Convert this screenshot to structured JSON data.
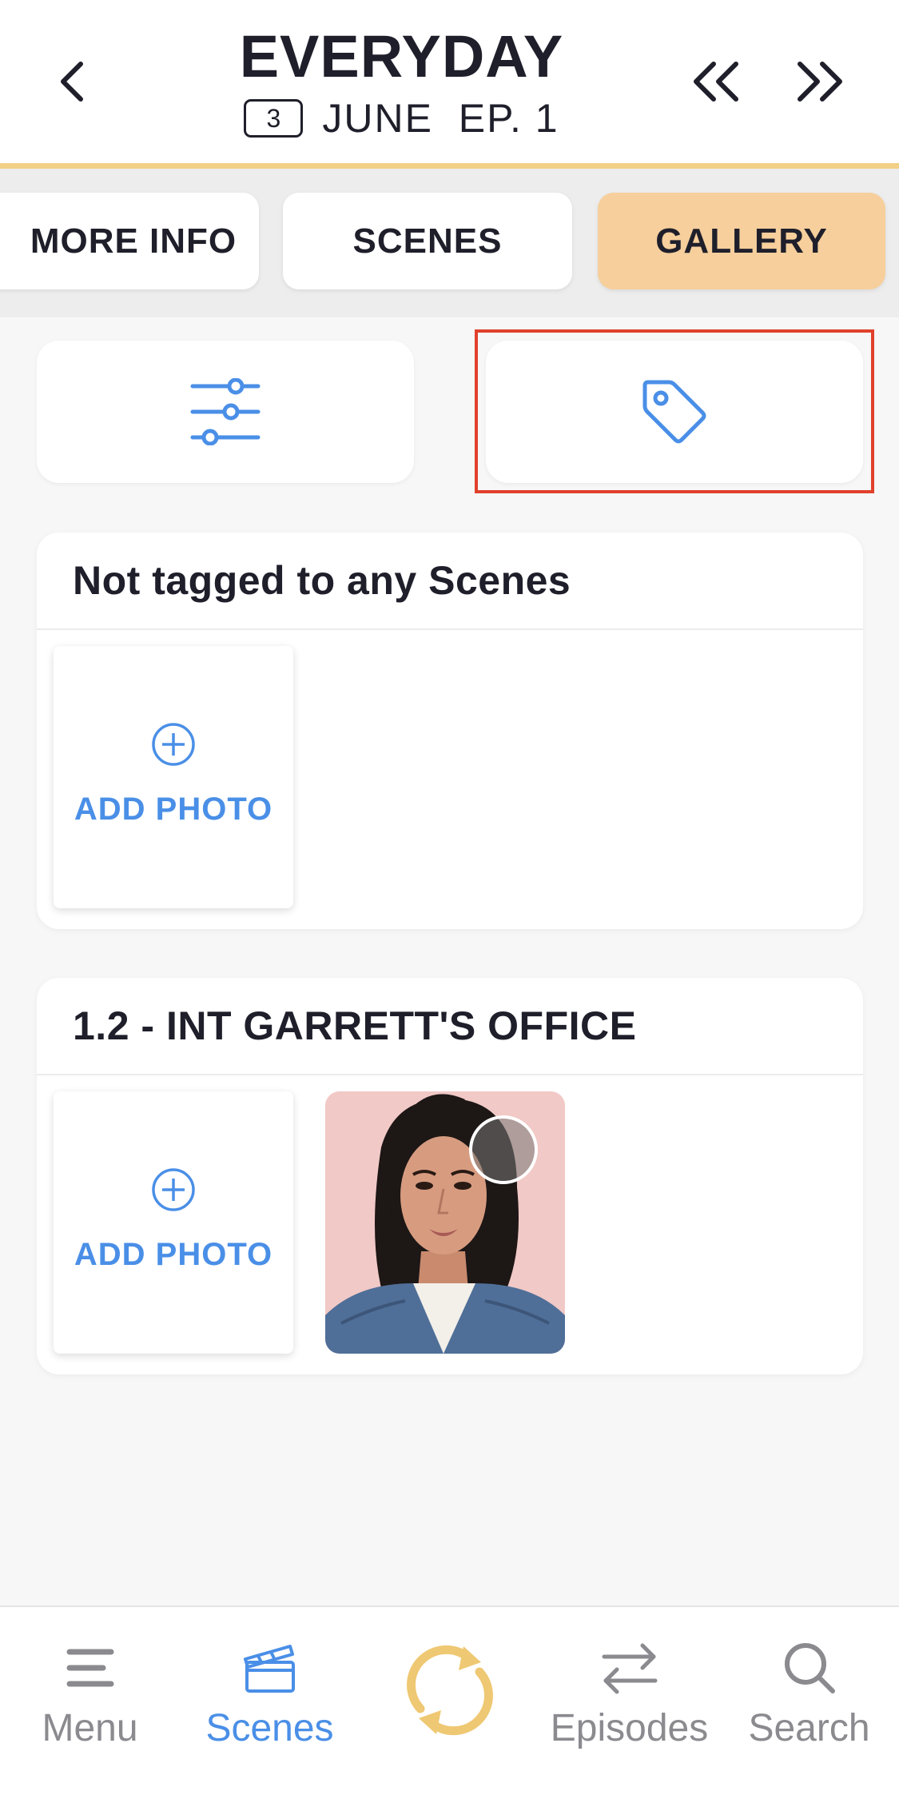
{
  "header": {
    "title": "EVERYDAY",
    "day_number": "3",
    "subtitle": "JUNE  EP. 1"
  },
  "tabs": [
    {
      "label": "MORE INFO"
    },
    {
      "label": "SCENES"
    },
    {
      "label": "GALLERY",
      "active": true
    }
  ],
  "sections": [
    {
      "title": "Not tagged to any Scenes",
      "add_label": "ADD PHOTO"
    },
    {
      "title": "1.2 - INT GARRETT'S OFFICE",
      "add_label": "ADD PHOTO"
    }
  ],
  "nav": {
    "items": [
      {
        "label": "Menu",
        "icon": "menu-icon"
      },
      {
        "label": "Scenes",
        "icon": "clapperboard-icon",
        "active": true
      },
      {
        "label": "",
        "icon": "sync-icon"
      },
      {
        "label": "Episodes",
        "icon": "swap-arrows-icon"
      },
      {
        "label": "Search",
        "icon": "search-icon"
      }
    ]
  },
  "colors": {
    "accent_blue": "#4a8fe7",
    "gold": "#f2cf86",
    "active_tab": "#f6cf9c",
    "highlight": "#e0412b"
  }
}
